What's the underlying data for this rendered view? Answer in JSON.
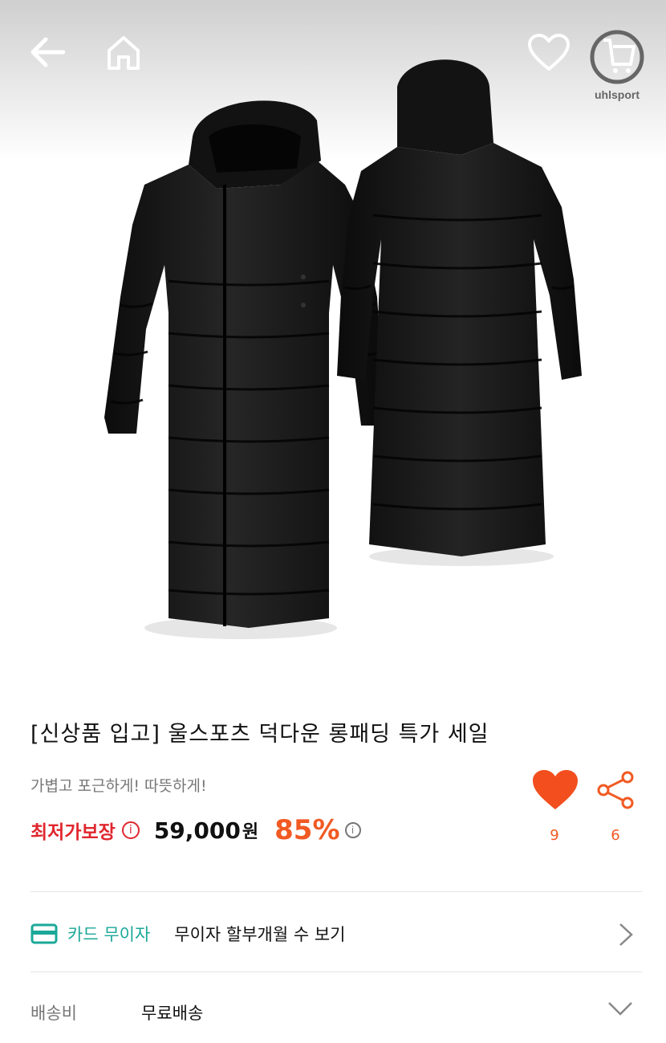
{
  "header": {
    "brand_text": "uhlsport",
    "icons": [
      "back-arrow-icon",
      "home-icon",
      "heart-outline-icon",
      "cart-icon"
    ]
  },
  "product": {
    "title": "[신상품 입고] 울스포츠 덕다운 롱패딩 특가 세일",
    "subtitle": "가볍고 포근하게! 따뜻하게!",
    "lowest_price_label": "최저가보장",
    "info_symbol": "i",
    "price": "59,000",
    "currency": "원",
    "discount": "85%",
    "like_count": "9",
    "share_count": "6"
  },
  "card_installment": {
    "label": "카드 무이자",
    "text": "무이자 할부개월 수 보기"
  },
  "shipping": {
    "label": "배송비",
    "value": "무료배송"
  },
  "colors": {
    "accent_red": "#e0262e",
    "accent_orange": "#f15a23",
    "teal": "#1aa898"
  }
}
